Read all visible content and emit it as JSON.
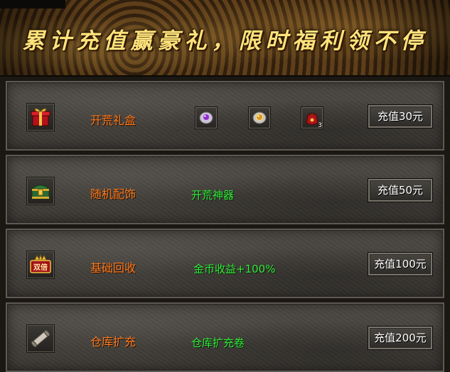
{
  "banner": {
    "title": "累计充值赢豪礼，限时福利领不停"
  },
  "rows": [
    {
      "icon": "red-gift-box-icon",
      "name": "开荒礼盒",
      "desc": "",
      "rewards": [
        {
          "icon": "purple-gem-icon",
          "count": ""
        },
        {
          "icon": "gold-gem-icon",
          "count": ""
        },
        {
          "icon": "red-pouch-icon",
          "count": "3"
        }
      ],
      "button": "充值30元"
    },
    {
      "icon": "treasure-chest-icon",
      "name": "随机配饰",
      "desc": "开荒神器",
      "rewards": [],
      "button": "充值50元"
    },
    {
      "icon": "double-badge-icon",
      "badge_text": "双倍",
      "name": "基础回收",
      "desc": "金币收益+100%",
      "rewards": [],
      "button": "充值100元"
    },
    {
      "icon": "scroll-icon",
      "name": "仓库扩充",
      "desc": "仓库扩充卷",
      "rewards": [],
      "button": "充值200元"
    }
  ]
}
